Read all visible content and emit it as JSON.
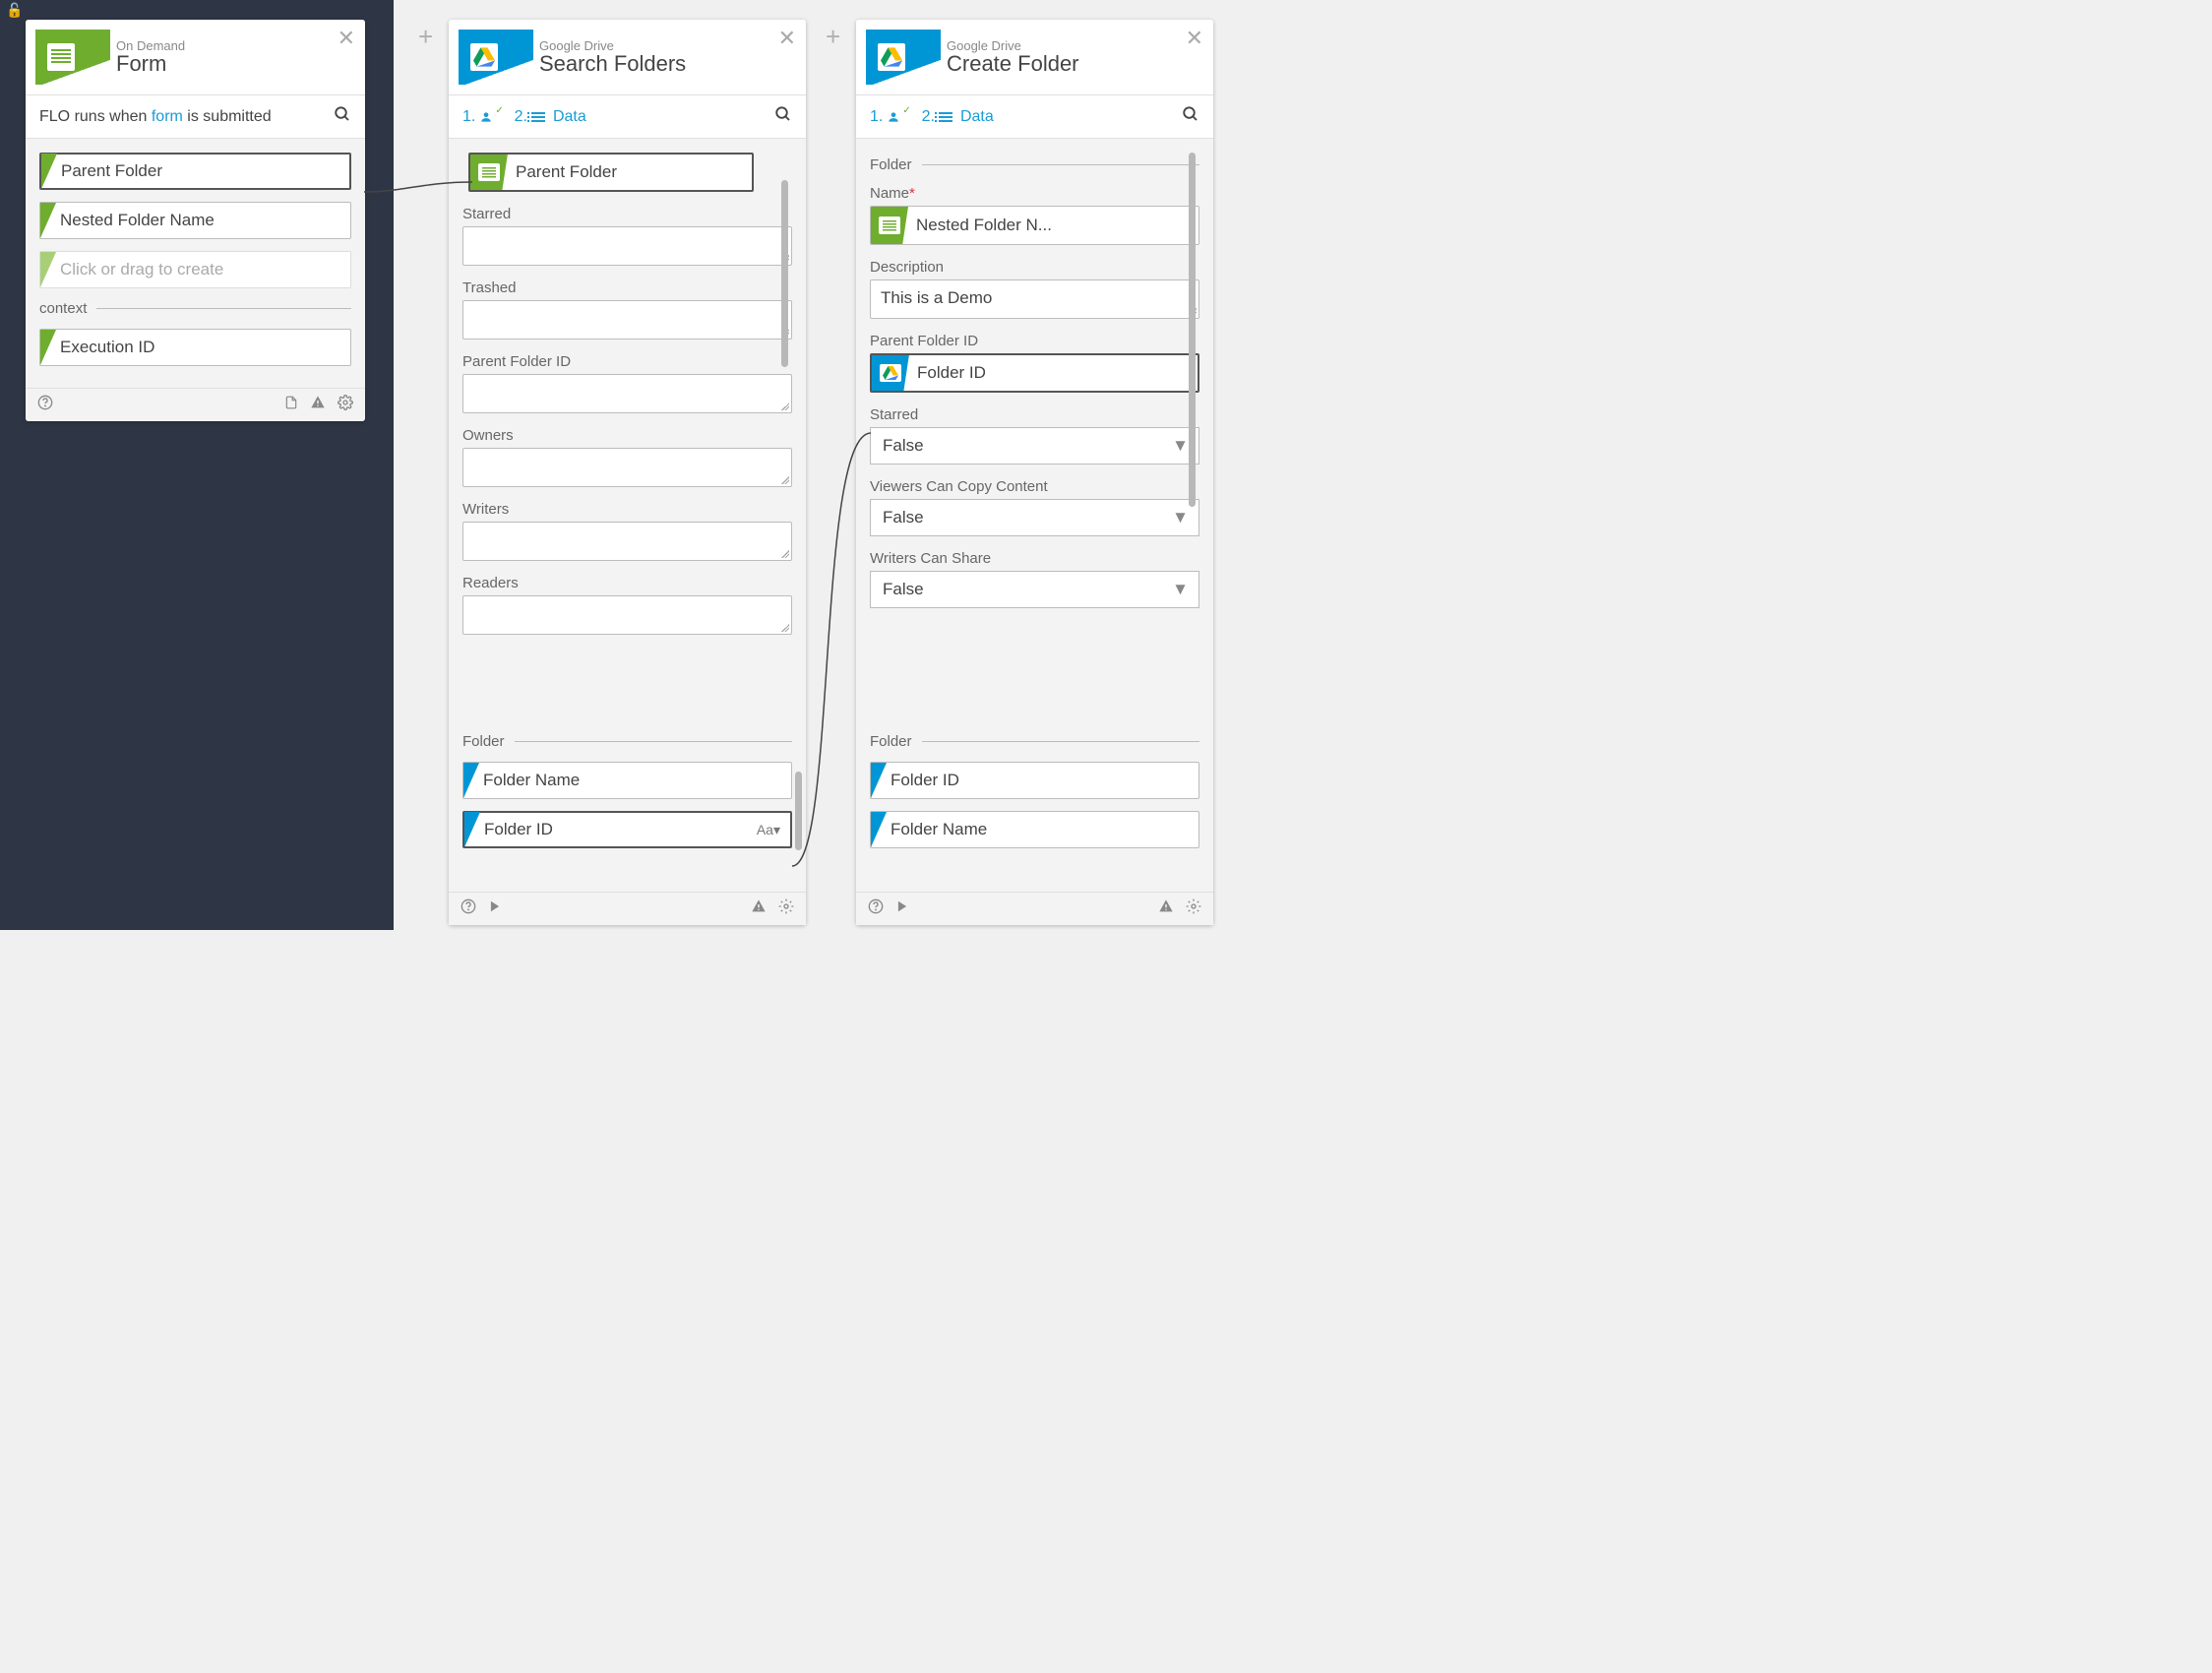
{
  "form_card": {
    "subtitle": "On Demand",
    "title": "Form",
    "runs_prefix": "FLO runs when",
    "runs_link": "form",
    "runs_suffix": "is submitted",
    "fields": [
      "Parent Folder",
      "Nested Folder Name"
    ],
    "placeholder": "Click or drag to create",
    "context_label": "context",
    "context_fields": [
      "Execution ID"
    ]
  },
  "search_card": {
    "subtitle": "Google Drive",
    "title": "Search Folders",
    "step1": "1.",
    "step2": "2.",
    "data_label": "Data",
    "pill_value": "Parent Folder",
    "input_labels": [
      "Starred",
      "Trashed",
      "Parent Folder ID",
      "Owners",
      "Writers",
      "Readers"
    ],
    "output_section": "Folder",
    "outputs": [
      "Folder Name",
      "Folder ID"
    ],
    "type_hint": "Aa"
  },
  "create_card": {
    "subtitle": "Google Drive",
    "title": "Create Folder",
    "step1": "1.",
    "step2": "2.",
    "data_label": "Data",
    "folder_section": "Folder",
    "name_label": "Name",
    "name_pill": "Nested Folder N...",
    "description_label": "Description",
    "description_value": "This is a Demo",
    "parent_id_label": "Parent Folder ID",
    "parent_id_pill": "Folder ID",
    "starred_label": "Starred",
    "starred_value": "False",
    "viewers_label": "Viewers Can Copy Content",
    "viewers_value": "False",
    "writers_label": "Writers Can Share",
    "writers_value": "False",
    "output_section": "Folder",
    "outputs": [
      "Folder ID",
      "Folder Name"
    ]
  }
}
